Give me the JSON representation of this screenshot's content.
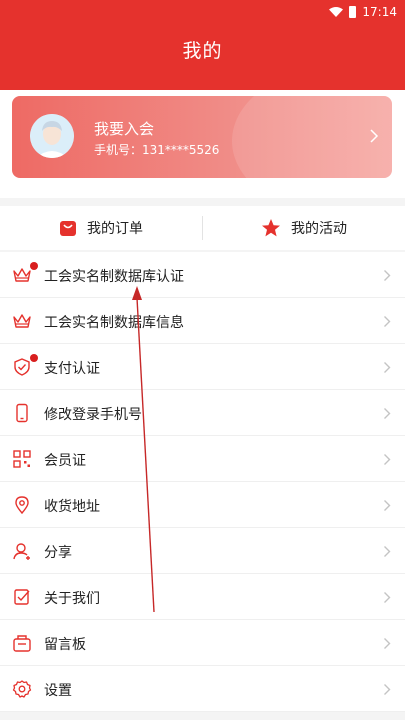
{
  "status_bar": {
    "time": "17:14"
  },
  "header": {
    "title": "我的"
  },
  "profile": {
    "name": "我要入会",
    "phone": "手机号：131****5526"
  },
  "tabs": [
    {
      "label": "我的订单",
      "icon": "bag-icon"
    },
    {
      "label": "我的活动",
      "icon": "star-icon"
    }
  ],
  "menu": [
    {
      "label": "工会实名制数据库认证",
      "icon": "crown-icon",
      "badge": true
    },
    {
      "label": "工会实名制数据库信息",
      "icon": "crown-icon",
      "badge": false
    },
    {
      "label": "支付认证",
      "icon": "shield-check-icon",
      "badge": true
    },
    {
      "label": "修改登录手机号",
      "icon": "phone-icon",
      "badge": false
    },
    {
      "label": "会员证",
      "icon": "qr-code-icon",
      "badge": false
    },
    {
      "label": "收货地址",
      "icon": "location-pin-icon",
      "badge": false
    },
    {
      "label": "分享",
      "icon": "share-user-icon",
      "badge": false
    },
    {
      "label": "关于我们",
      "icon": "about-icon",
      "badge": false
    },
    {
      "label": "留言板",
      "icon": "message-board-icon",
      "badge": false
    },
    {
      "label": "设置",
      "icon": "gear-icon",
      "badge": false
    }
  ],
  "colors": {
    "brand": "#e5322d",
    "accent_icon": "#e5322d",
    "badge": "#d81e1e"
  }
}
